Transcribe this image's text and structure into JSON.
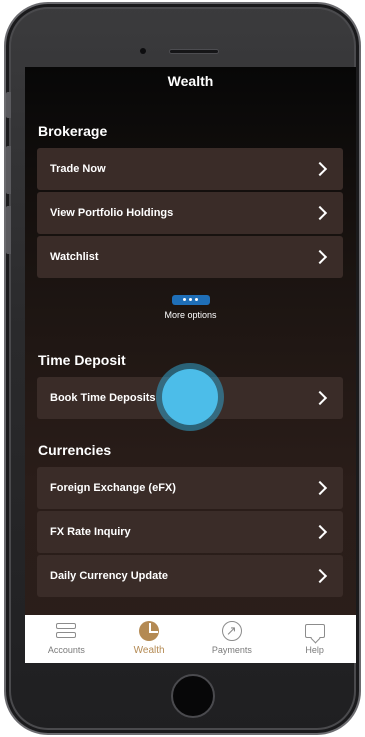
{
  "screen": {
    "title": "Wealth"
  },
  "brokerage": {
    "title": "Brokerage",
    "items": [
      {
        "label": "Trade Now"
      },
      {
        "label": "View Portfolio Holdings"
      },
      {
        "label": "Watchlist"
      }
    ],
    "more_label": "More options"
  },
  "time_deposit": {
    "title": "Time Deposit",
    "items": [
      {
        "label": "Book Time Deposits"
      }
    ]
  },
  "currencies": {
    "title": "Currencies",
    "items": [
      {
        "label": "Foreign Exchange (eFX)"
      },
      {
        "label": "FX Rate Inquiry"
      },
      {
        "label": "Daily Currency Update"
      }
    ]
  },
  "tabbar": {
    "tabs": [
      {
        "label": "Accounts",
        "icon": "accounts-icon"
      },
      {
        "label": "Wealth",
        "icon": "wealth-icon",
        "active": true
      },
      {
        "label": "Payments",
        "icon": "payments-icon"
      },
      {
        "label": "Help",
        "icon": "help-icon"
      }
    ]
  },
  "colors": {
    "accent": "#b48a53",
    "more_button": "#1f6fb8",
    "tap_indicator": "#4cbde9"
  }
}
